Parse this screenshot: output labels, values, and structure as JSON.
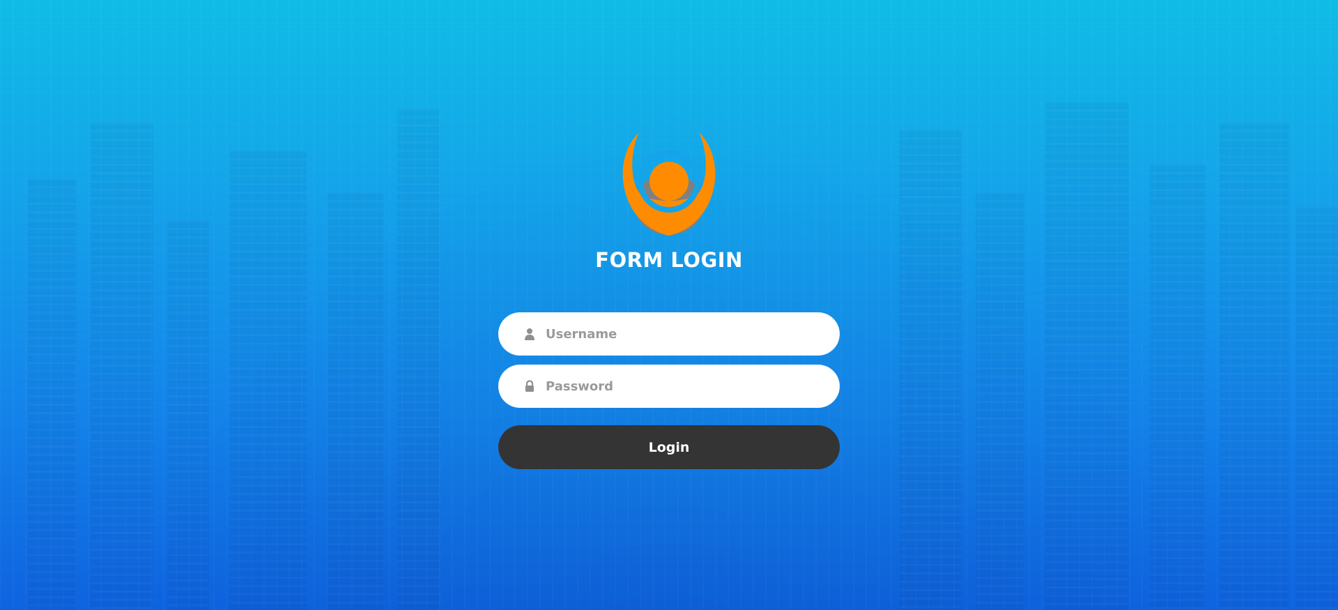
{
  "page": {
    "title": "FORM LOGIN"
  },
  "logo": {
    "icon": "person-logo-icon",
    "colors": {
      "primary": "#ff8c00",
      "secondary": "#808080"
    }
  },
  "form": {
    "username": {
      "icon": "user-icon",
      "placeholder": "Username",
      "value": ""
    },
    "password": {
      "icon": "lock-icon",
      "placeholder": "Password",
      "value": ""
    },
    "login_label": "Login"
  },
  "colors": {
    "background_top": "#10bde6",
    "background_bottom": "#0f63df",
    "button": "#343434",
    "text_light": "#ffffff",
    "placeholder": "#9a9a9a"
  }
}
